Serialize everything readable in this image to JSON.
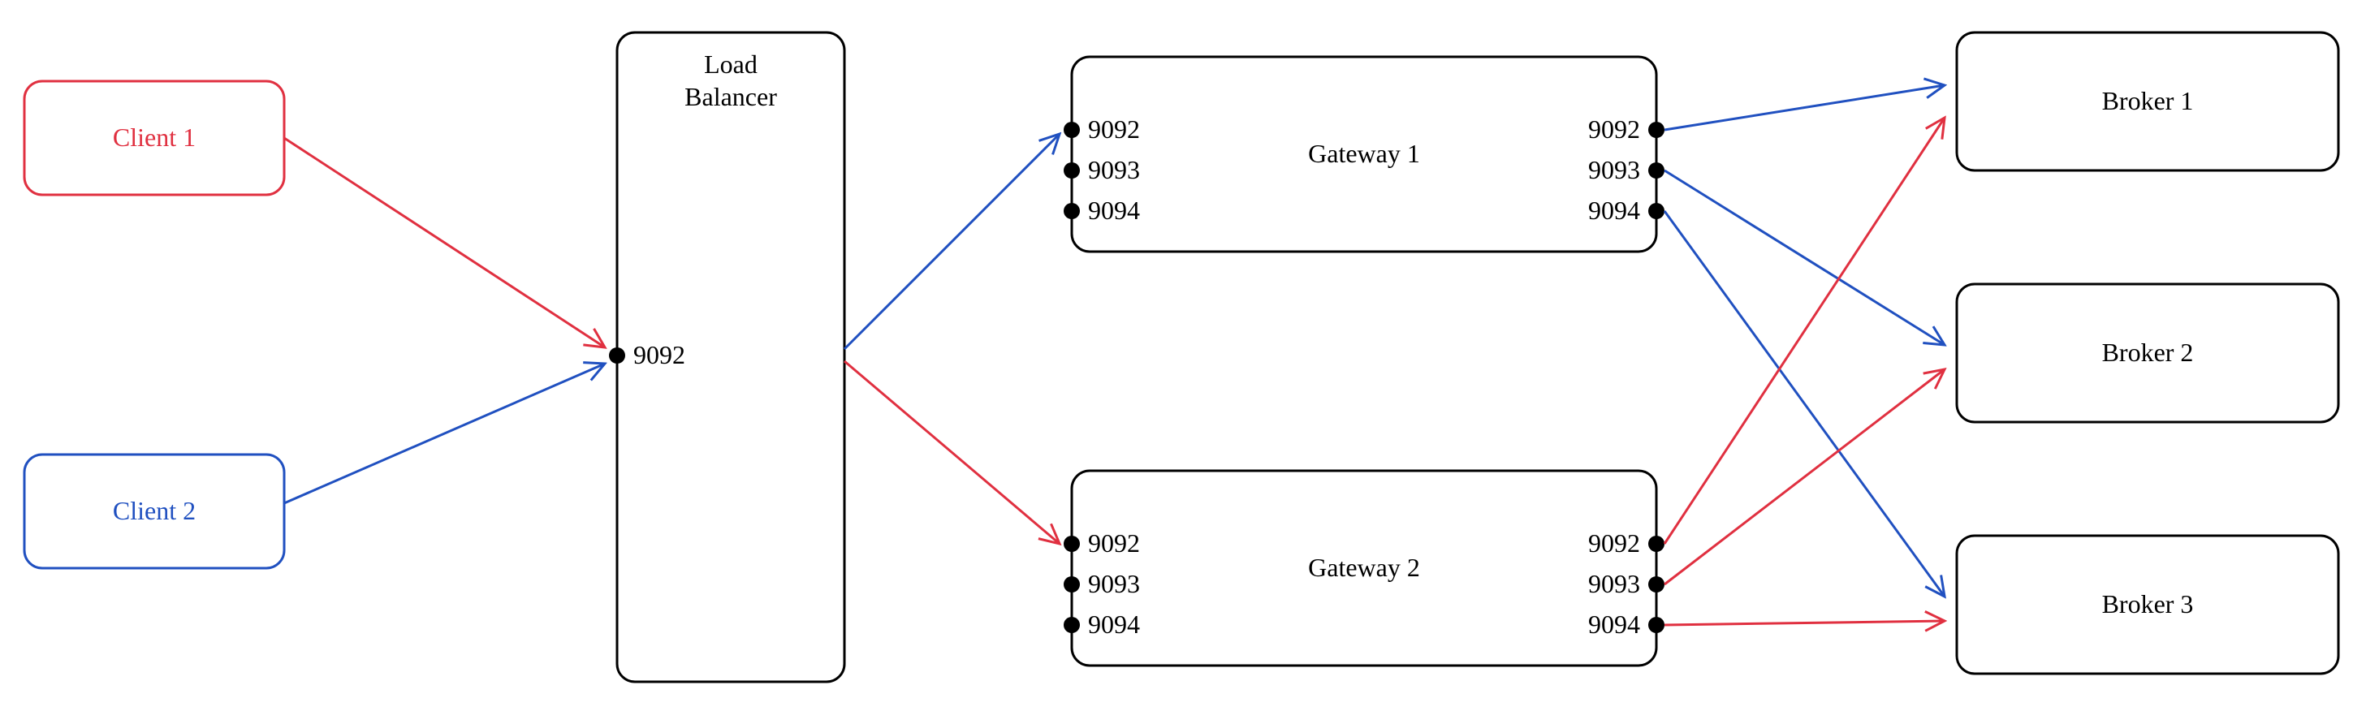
{
  "clients": {
    "client1": {
      "label": "Client 1"
    },
    "client2": {
      "label": "Client 2"
    }
  },
  "loadBalancer": {
    "label_line1": "Load",
    "label_line2": "Balancer",
    "port": "9092"
  },
  "gateways": {
    "gateway1": {
      "label": "Gateway 1",
      "in_ports": [
        "9092",
        "9093",
        "9094"
      ],
      "out_ports": [
        "9092",
        "9093",
        "9094"
      ]
    },
    "gateway2": {
      "label": "Gateway 2",
      "in_ports": [
        "9092",
        "9093",
        "9094"
      ],
      "out_ports": [
        "9092",
        "9093",
        "9094"
      ]
    }
  },
  "brokers": {
    "broker1": {
      "label": "Broker 1"
    },
    "broker2": {
      "label": "Broker 2"
    },
    "broker3": {
      "label": "Broker 3"
    }
  }
}
